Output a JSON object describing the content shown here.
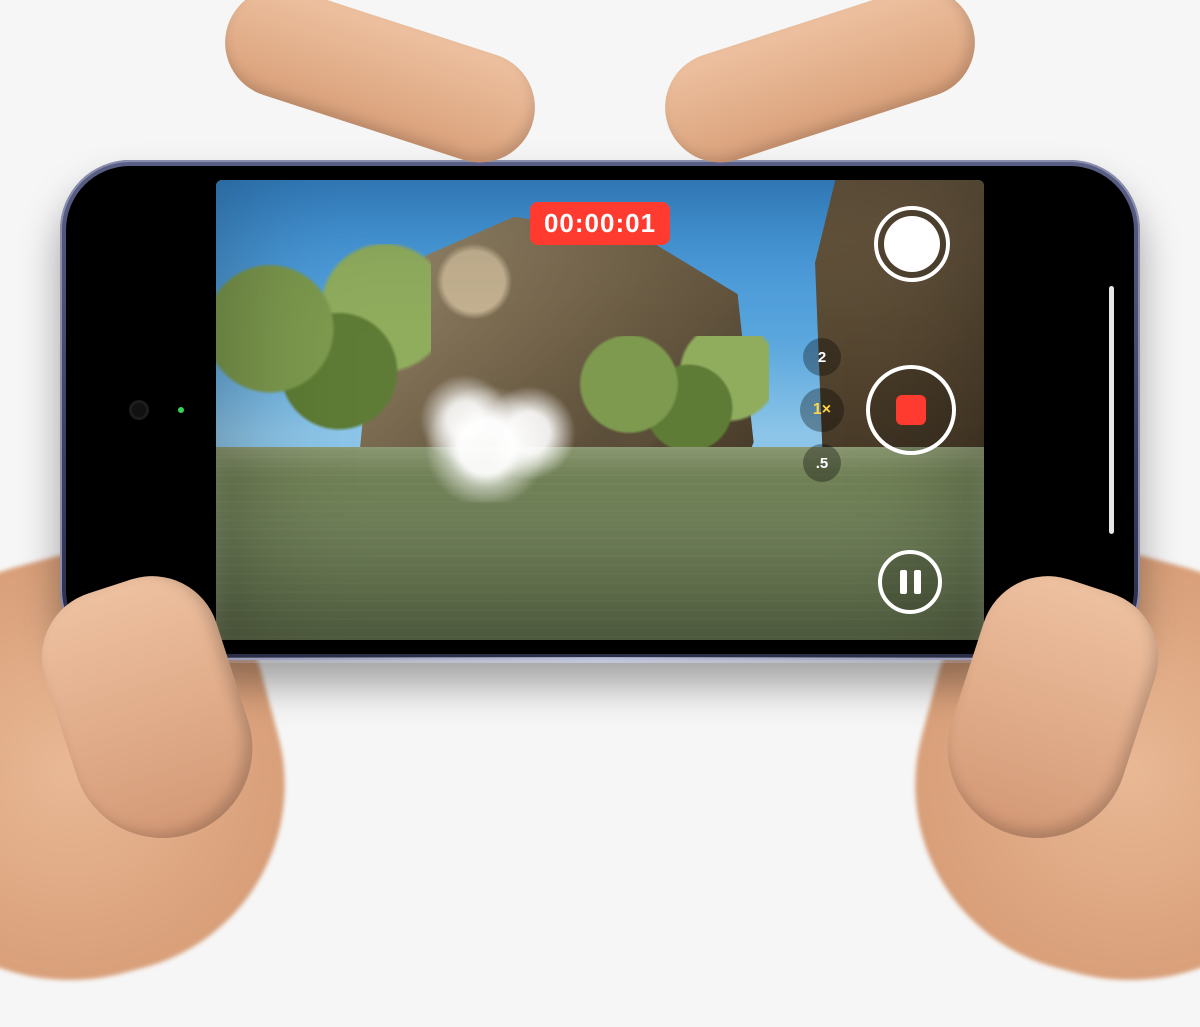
{
  "recording": {
    "timer": "00:00:01",
    "chip_bg": "#ff3b30",
    "chip_fg": "#ffffff"
  },
  "zoom": {
    "option_top": "2",
    "selected": "1×",
    "option_bottom": ".5",
    "selected_color": "#ffd54a"
  },
  "controls": {
    "shutter_label": "Photo shutter",
    "record_label": "Stop recording",
    "record_color": "#ff3b30",
    "pause_label": "Pause"
  },
  "hardware": {
    "camera_indicator": "green"
  },
  "scene_description": "River with rocky cliffs, greenery, and a splash in the water"
}
